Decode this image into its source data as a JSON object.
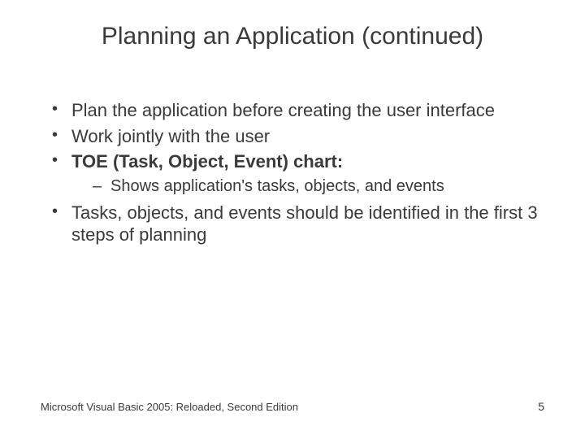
{
  "title": "Planning an Application (continued)",
  "bullets": {
    "b1": "Plan the application before creating the user interface",
    "b2": "Work jointly with the user",
    "b3": "TOE (Task, Object, Event) chart",
    "b3_sub1": "Shows application's tasks, objects, and events",
    "b4": "Tasks, objects, and events should be identified in the first 3 steps of planning"
  },
  "footer": {
    "source": "Microsoft Visual Basic 2005: Reloaded, Second Edition",
    "page": "5"
  }
}
